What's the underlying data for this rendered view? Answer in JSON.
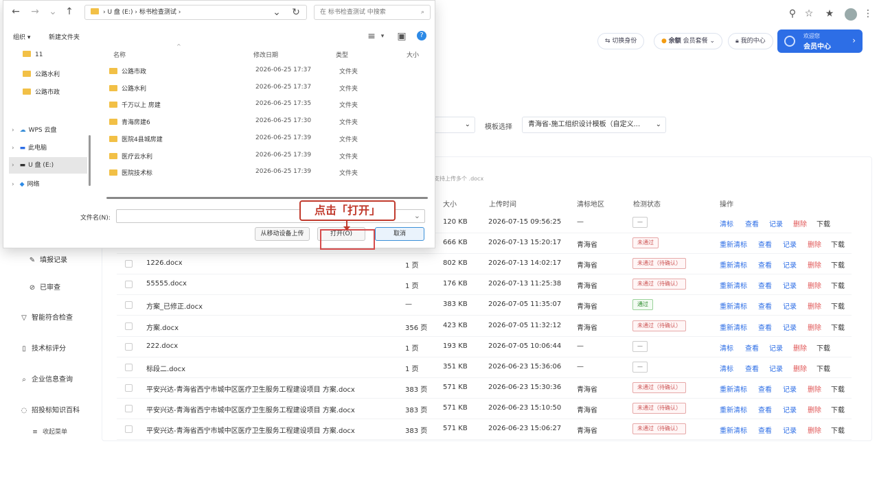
{
  "browser": {
    "icons": [
      "search-icon",
      "star-icon",
      "bookmark-star-icon",
      "avatar",
      "more-icon"
    ]
  },
  "header": {
    "btn_switch": "切换身份",
    "btn_balance_label": "余额",
    "btn_balance_value": "会员套餐",
    "btn_message": "我的中心",
    "user_line1": "欢迎您",
    "user_line2": "会员中心"
  },
  "filters": {
    "label_template": "模板选择",
    "select_template": "青海省-施工组织设计模板（自定义...",
    "select_left": ""
  },
  "sidebar": {
    "items": [
      {
        "label": "填报记录",
        "icon": "pen-icon"
      },
      {
        "label": "已审查",
        "icon": "check-circle-icon"
      },
      {
        "label": "智能符合检查",
        "icon": "filter-icon"
      },
      {
        "label": "技术标评分",
        "icon": "doc-icon"
      },
      {
        "label": "企业信息查询",
        "icon": "search-icon"
      },
      {
        "label": "招投标知识百科",
        "icon": "chat-icon"
      },
      {
        "label": "收起菜单",
        "icon": "menu-icon"
      }
    ]
  },
  "main": {
    "hint": "支持上传多个 .docx",
    "columns": [
      "大小",
      "上传时间",
      "清标地区",
      "检测状态",
      "操作"
    ],
    "rows": [
      {
        "name": "",
        "pages": "",
        "size": "120 KB",
        "time": "2026-07-15 09:56:25",
        "region": "—",
        "status": "—",
        "status_kind": "none",
        "actions": [
          "清标",
          "查看",
          "记录",
          "删除",
          "下载"
        ]
      },
      {
        "name": "",
        "pages": "",
        "size": "666 KB",
        "time": "2026-07-13 15:20:17",
        "region": "青海省",
        "status": "未通过",
        "status_kind": "warn",
        "actions": [
          "重新清标",
          "查看",
          "记录",
          "删除",
          "下载"
        ]
      },
      {
        "name": "1226.docx",
        "pages": "1 页",
        "size": "802 KB",
        "time": "2026-07-13 14:02:17",
        "region": "青海省",
        "status": "未通过（待确认）",
        "status_kind": "warn",
        "actions": [
          "重新清标",
          "查看",
          "记录",
          "删除",
          "下载"
        ]
      },
      {
        "name": "55555.docx",
        "pages": "1 页",
        "size": "176 KB",
        "time": "2026-07-13 11:25:38",
        "region": "青海省",
        "status": "未通过（待确认）",
        "status_kind": "warn",
        "actions": [
          "重新清标",
          "查看",
          "记录",
          "删除",
          "下载"
        ]
      },
      {
        "name": "方案_已修正.docx",
        "pages": "—",
        "size": "383 KB",
        "time": "2026-07-05 11:35:07",
        "region": "青海省",
        "status": "通过",
        "status_kind": "ok",
        "actions": [
          "重新清标",
          "查看",
          "记录",
          "删除",
          "下载"
        ]
      },
      {
        "name": "方案.docx",
        "pages": "356 页",
        "size": "423 KB",
        "time": "2026-07-05 11:32:12",
        "region": "青海省",
        "status": "未通过（待确认）",
        "status_kind": "warn",
        "actions": [
          "重新清标",
          "查看",
          "记录",
          "删除",
          "下载"
        ]
      },
      {
        "name": "222.docx",
        "pages": "1 页",
        "size": "193 KB",
        "time": "2026-07-05 10:06:44",
        "region": "—",
        "status": "—",
        "status_kind": "none",
        "actions": [
          "清标",
          "查看",
          "记录",
          "删除",
          "下载"
        ]
      },
      {
        "name": "标段二.docx",
        "pages": "1 页",
        "size": "351 KB",
        "time": "2026-06-23 15:36:06",
        "region": "—",
        "status": "—",
        "status_kind": "none",
        "actions": [
          "清标",
          "查看",
          "记录",
          "删除",
          "下载"
        ]
      },
      {
        "name": "平安兴达-青海省西宁市城中区医疗卫生服务工程建设项目 方案.docx",
        "pages": "383 页",
        "size": "571 KB",
        "time": "2026-06-23 15:30:36",
        "region": "青海省",
        "status": "未通过（待确认）",
        "status_kind": "warn",
        "actions": [
          "重新清标",
          "查看",
          "记录",
          "删除",
          "下载"
        ]
      },
      {
        "name": "平安兴达-青海省西宁市城中区医疗卫生服务工程建设项目 方案.docx",
        "pages": "383 页",
        "size": "571 KB",
        "time": "2026-06-23 15:10:50",
        "region": "青海省",
        "status": "未通过（待确认）",
        "status_kind": "warn",
        "actions": [
          "重新清标",
          "查看",
          "记录",
          "删除",
          "下载"
        ]
      },
      {
        "name": "平安兴达-青海省西宁市城中区医疗卫生服务工程建设项目 方案.docx",
        "pages": "383 页",
        "size": "571 KB",
        "time": "2026-06-23 15:06:27",
        "region": "青海省",
        "status": "未通过（待确认）",
        "status_kind": "warn",
        "actions": [
          "重新清标",
          "查看",
          "记录",
          "删除",
          "下载"
        ]
      }
    ]
  },
  "dialog": {
    "address": "›  U 盘 (E:)  ›  标书检查测试  ›",
    "search_placeholder": "在 标书检查测试 中搜索",
    "organize": "组织 ▾",
    "new_folder": "新建文件夹",
    "nav_items": [
      {
        "label": "11",
        "icon": "folder-icon"
      },
      {
        "label": "公路水利",
        "icon": "folder-icon"
      },
      {
        "label": "公路市政",
        "icon": "folder-icon"
      },
      {
        "label": "WPS 云盘",
        "icon": "cloud-icon"
      },
      {
        "label": "此电脑",
        "icon": "computer-icon"
      },
      {
        "label": "U 盘 (E:)",
        "icon": "drive-icon"
      },
      {
        "label": "网络",
        "icon": "network-icon"
      }
    ],
    "columns": [
      "名称",
      "修改日期",
      "类型",
      "大小"
    ],
    "files": [
      {
        "name": "公路市政",
        "date": "2026-06-25 17:37",
        "type": "文件夹"
      },
      {
        "name": "公路水利",
        "date": "2026-06-25 17:37",
        "type": "文件夹"
      },
      {
        "name": "千万以上 房建",
        "date": "2026-06-25 17:35",
        "type": "文件夹"
      },
      {
        "name": "青海房建6",
        "date": "2026-06-25 17:30",
        "type": "文件夹"
      },
      {
        "name": "医院4县城房建",
        "date": "2026-06-25 17:39",
        "type": "文件夹"
      },
      {
        "name": "医疗云水利",
        "date": "2026-06-25 17:39",
        "type": "文件夹"
      },
      {
        "name": "医院技术标",
        "date": "2026-06-25 17:39",
        "type": "文件夹"
      }
    ],
    "filename_label": "文件名(N):",
    "filename_value": "",
    "btn_mobile": "从移动设备上传",
    "btn_open": "打开(O)",
    "btn_cancel": "取消"
  },
  "annotation": {
    "callout": "点击「打开」",
    "color": "#c0392b"
  }
}
